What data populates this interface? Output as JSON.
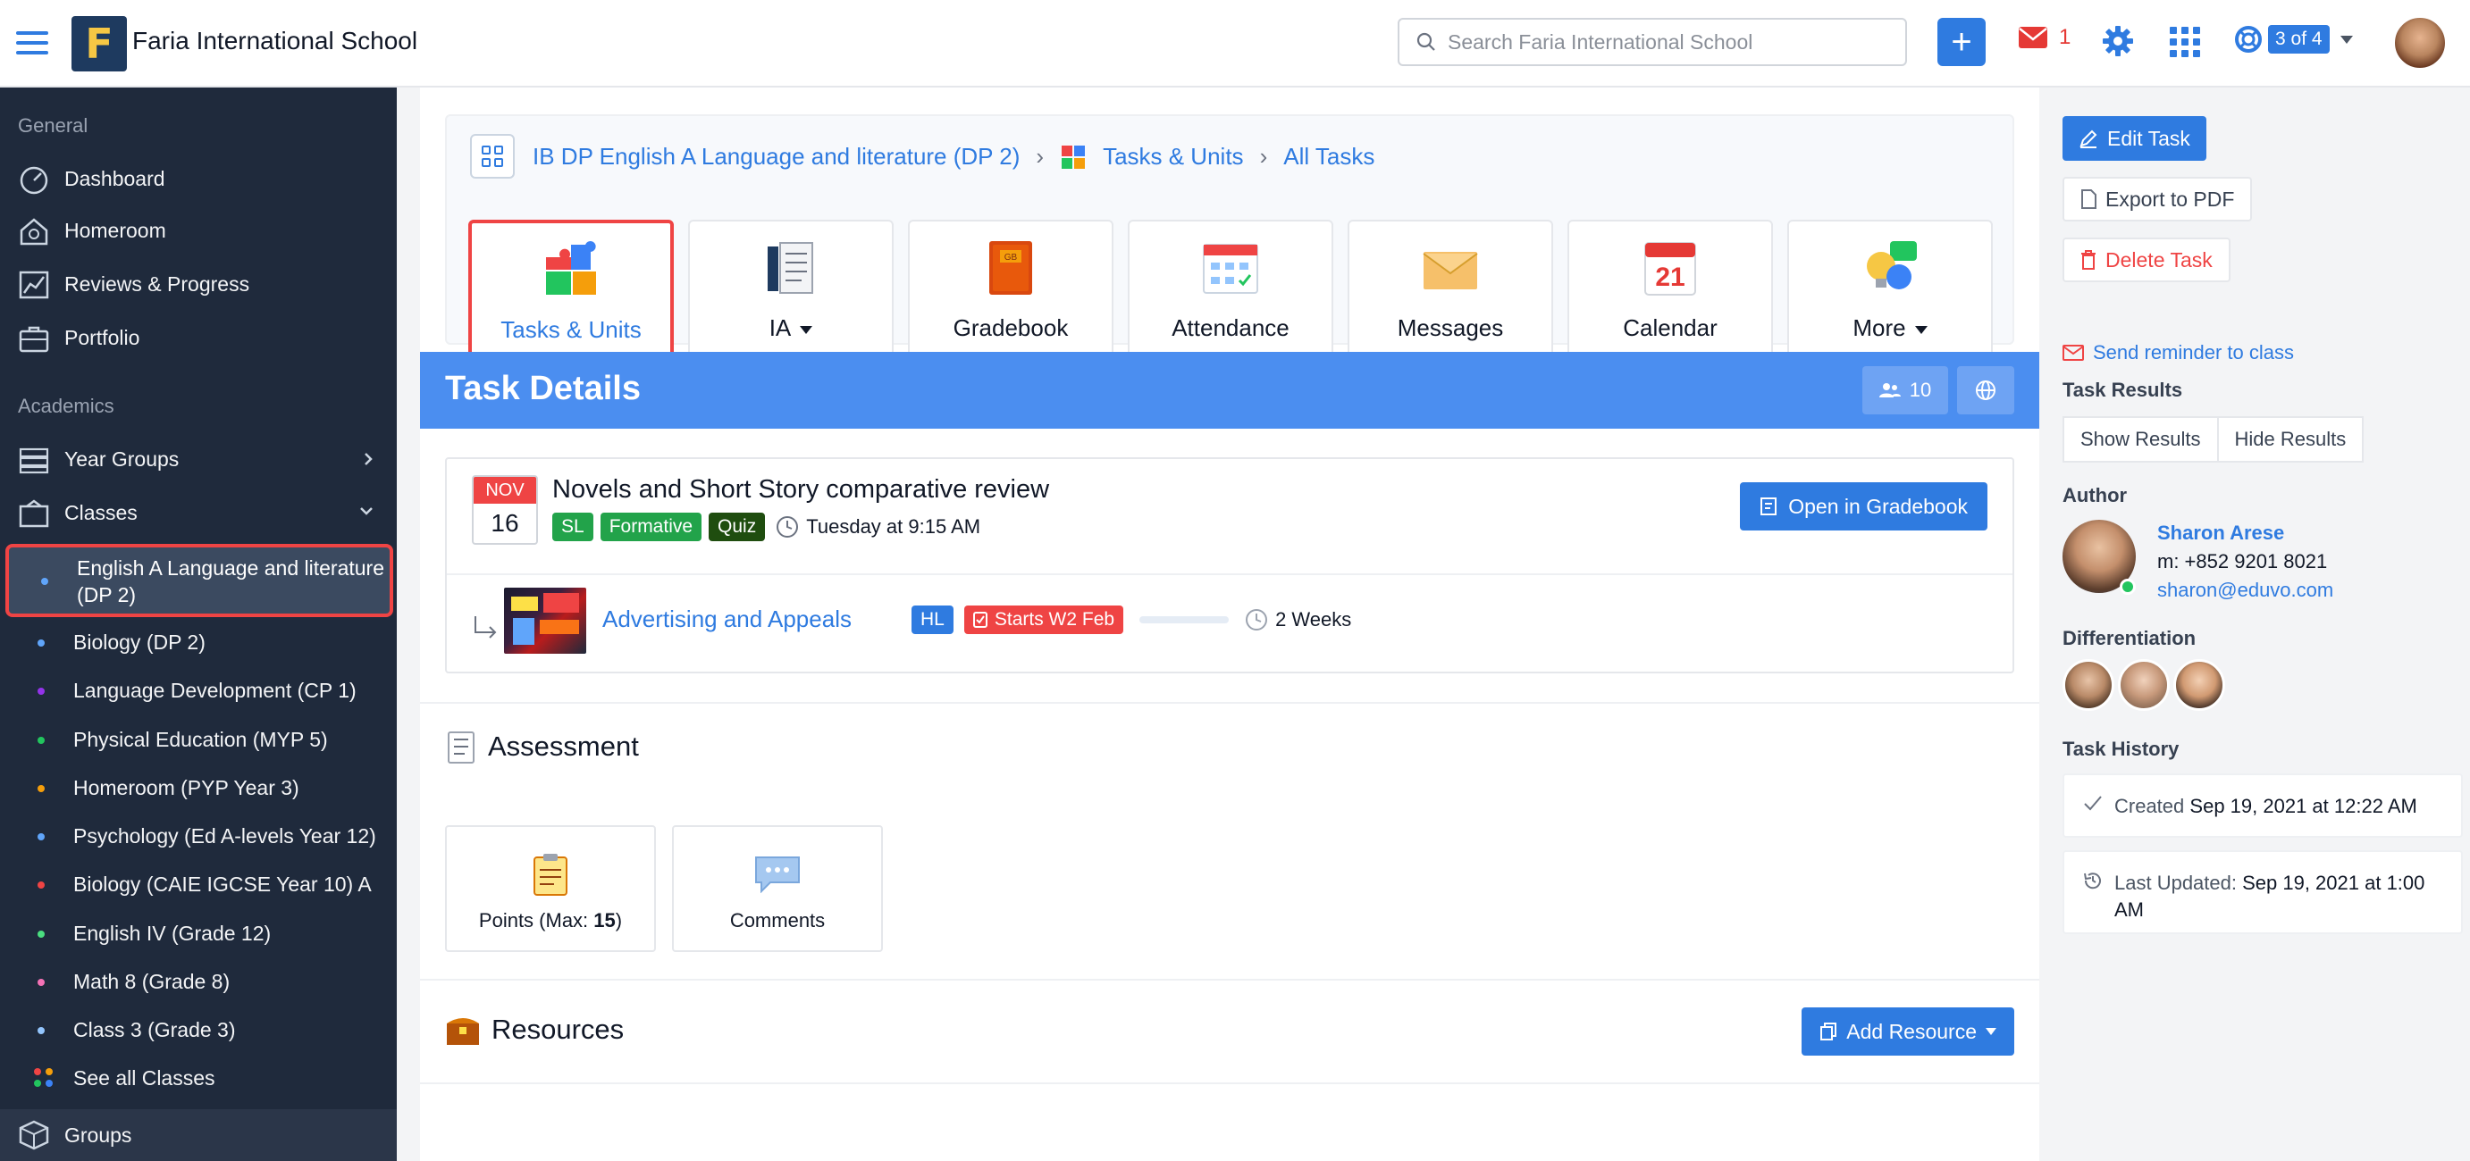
{
  "header": {
    "logo_letter": "F",
    "school_name": "Faria International School",
    "search_placeholder": "Search Faria International School",
    "mail_count": "1",
    "help_badge": "3 of 4"
  },
  "sidebar": {
    "general_label": "General",
    "general_items": [
      {
        "label": "Dashboard",
        "icon": "dashboard-icon"
      },
      {
        "label": "Homeroom",
        "icon": "homeroom-icon"
      },
      {
        "label": "Reviews & Progress",
        "icon": "chart-icon"
      },
      {
        "label": "Portfolio",
        "icon": "briefcase-icon"
      }
    ],
    "academics_label": "Academics",
    "year_groups": "Year Groups",
    "classes": "Classes",
    "class_items": [
      {
        "label": "English A Language and literature (DP 2)",
        "dot": "#60a5fa"
      },
      {
        "label": "Biology (DP 2)",
        "dot": "#60a5fa"
      },
      {
        "label": "Language Development (CP 1)",
        "dot": "#9333ea"
      },
      {
        "label": "Physical Education (MYP 5)",
        "dot": "#22c55e"
      },
      {
        "label": "Homeroom (PYP Year 3)",
        "dot": "#f59e0b"
      },
      {
        "label": "Psychology (Ed A-levels Year 12)",
        "dot": "#60a5fa"
      },
      {
        "label": "Biology (CAIE IGCSE Year 10) A",
        "dot": "#ef4444"
      },
      {
        "label": "English IV (Grade 12)",
        "dot": "#4ade80"
      },
      {
        "label": "Math 8 (Grade 8)",
        "dot": "#f472b6"
      },
      {
        "label": "Class 3 (Grade 3)",
        "dot": "#93c5fd"
      }
    ],
    "see_all": "See all Classes",
    "groups": "Groups"
  },
  "breadcrumb": {
    "course": "IB DP English A Language and literature (DP 2)",
    "section": "Tasks & Units",
    "page": "All Tasks"
  },
  "nav_tiles": [
    {
      "label": "Tasks & Units",
      "icon": "puzzle-icon",
      "active": true
    },
    {
      "label": "IA",
      "icon": "ia-icon",
      "dropdown": true
    },
    {
      "label": "Gradebook",
      "icon": "gradebook-icon",
      "art_text": "GB"
    },
    {
      "label": "Attendance",
      "icon": "attendance-icon"
    },
    {
      "label": "Messages",
      "icon": "envelope-icon"
    },
    {
      "label": "Calendar",
      "icon": "calendar-icon",
      "art_text": "21"
    },
    {
      "label": "More",
      "icon": "lightbulb-icon",
      "dropdown": true
    }
  ],
  "task_details": {
    "title": "Task Details",
    "student_count": "10"
  },
  "task": {
    "month": "NOV",
    "day": "16",
    "title": "Novels and Short Story comparative review",
    "tags": [
      {
        "label": "SL",
        "color": "#22a34a"
      },
      {
        "label": "Formative",
        "color": "#22a34a"
      },
      {
        "label": "Quiz",
        "color": "#1f4d0f"
      }
    ],
    "due": "Tuesday at 9:15 AM",
    "open_gradebook": "Open in Gradebook",
    "unit_name": "Advertising and Appeals",
    "unit_level": "HL",
    "unit_start": "Starts W2 Feb",
    "unit_duration": "2 Weeks"
  },
  "assessment": {
    "title": "Assessment",
    "points_label": "Points (Max: ",
    "points_max": "15",
    "points_close": ")",
    "comments_label": "Comments"
  },
  "resources": {
    "title": "Resources",
    "add_label": "Add Resource"
  },
  "right_panel": {
    "edit_task": "Edit Task",
    "export_pdf": "Export to PDF",
    "delete_task": "Delete Task",
    "send_reminder": "Send reminder to class",
    "task_results_label": "Task Results",
    "show_results": "Show Results",
    "hide_results": "Hide Results",
    "author_label": "Author",
    "author_name": "Sharon Arese",
    "author_phone": "m: +852 9201 8021",
    "author_email": "sharon@eduvo.com",
    "differentiation_label": "Differentiation",
    "task_history_label": "Task History",
    "created_label": "Created",
    "created_value": "Sep 19, 2021 at 12:22 AM",
    "updated_label": "Last Updated:",
    "updated_value": "Sep 19, 2021 at 1:00 AM"
  }
}
